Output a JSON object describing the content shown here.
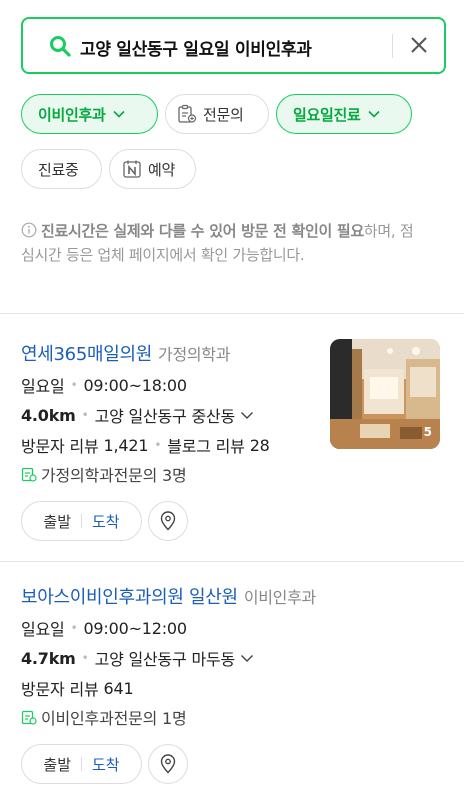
{
  "search": {
    "query": "고양 일산동구 일요일 이비인후과"
  },
  "filters": [
    {
      "label": "이비인후과",
      "active": true,
      "icon": "chevron-down-icon"
    },
    {
      "label": "전문의",
      "active": false,
      "icon": "doctor-badge-icon"
    },
    {
      "label": "일요일진료",
      "active": true,
      "icon": "chevron-down-icon"
    },
    {
      "label": "진료중",
      "active": false,
      "icon": ""
    },
    {
      "label": "예약",
      "active": false,
      "icon": "naver-booking-icon"
    }
  ],
  "notice": {
    "bold": "진료시간은 실제와 다를 수 있어 방문 전 확인이 필요",
    "rest": "하며, 점심시간 등은 업체 페이지에서 확인 가능합니다."
  },
  "results": [
    {
      "name": "연세365매일의원",
      "category": "가정의학과",
      "day": "일요일",
      "hours": "09:00~18:00",
      "distance": "4.0km",
      "address": "고양 일산동구 중산동",
      "visitor_review_label": "방문자 리뷰",
      "visitor_reviews": "1,421",
      "blog_review_label": "블로그 리뷰",
      "blog_reviews": "28",
      "specialists": "가정의학과전문의 3명",
      "photo_count": "5",
      "start_label": "출발",
      "arrive_label": "도착"
    },
    {
      "name": "보아스이비인후과의원 일산원",
      "category": "이비인후과",
      "day": "일요일",
      "hours": "09:00~12:00",
      "distance": "4.7km",
      "address": "고양 일산동구 마두동",
      "visitor_review_label": "방문자 리뷰",
      "visitor_reviews": "641",
      "specialists": "이비인후과전문의 1명",
      "start_label": "출발",
      "arrive_label": "도착"
    }
  ],
  "colors": {
    "accent": "#19ce60",
    "link": "#1b5fb8"
  }
}
